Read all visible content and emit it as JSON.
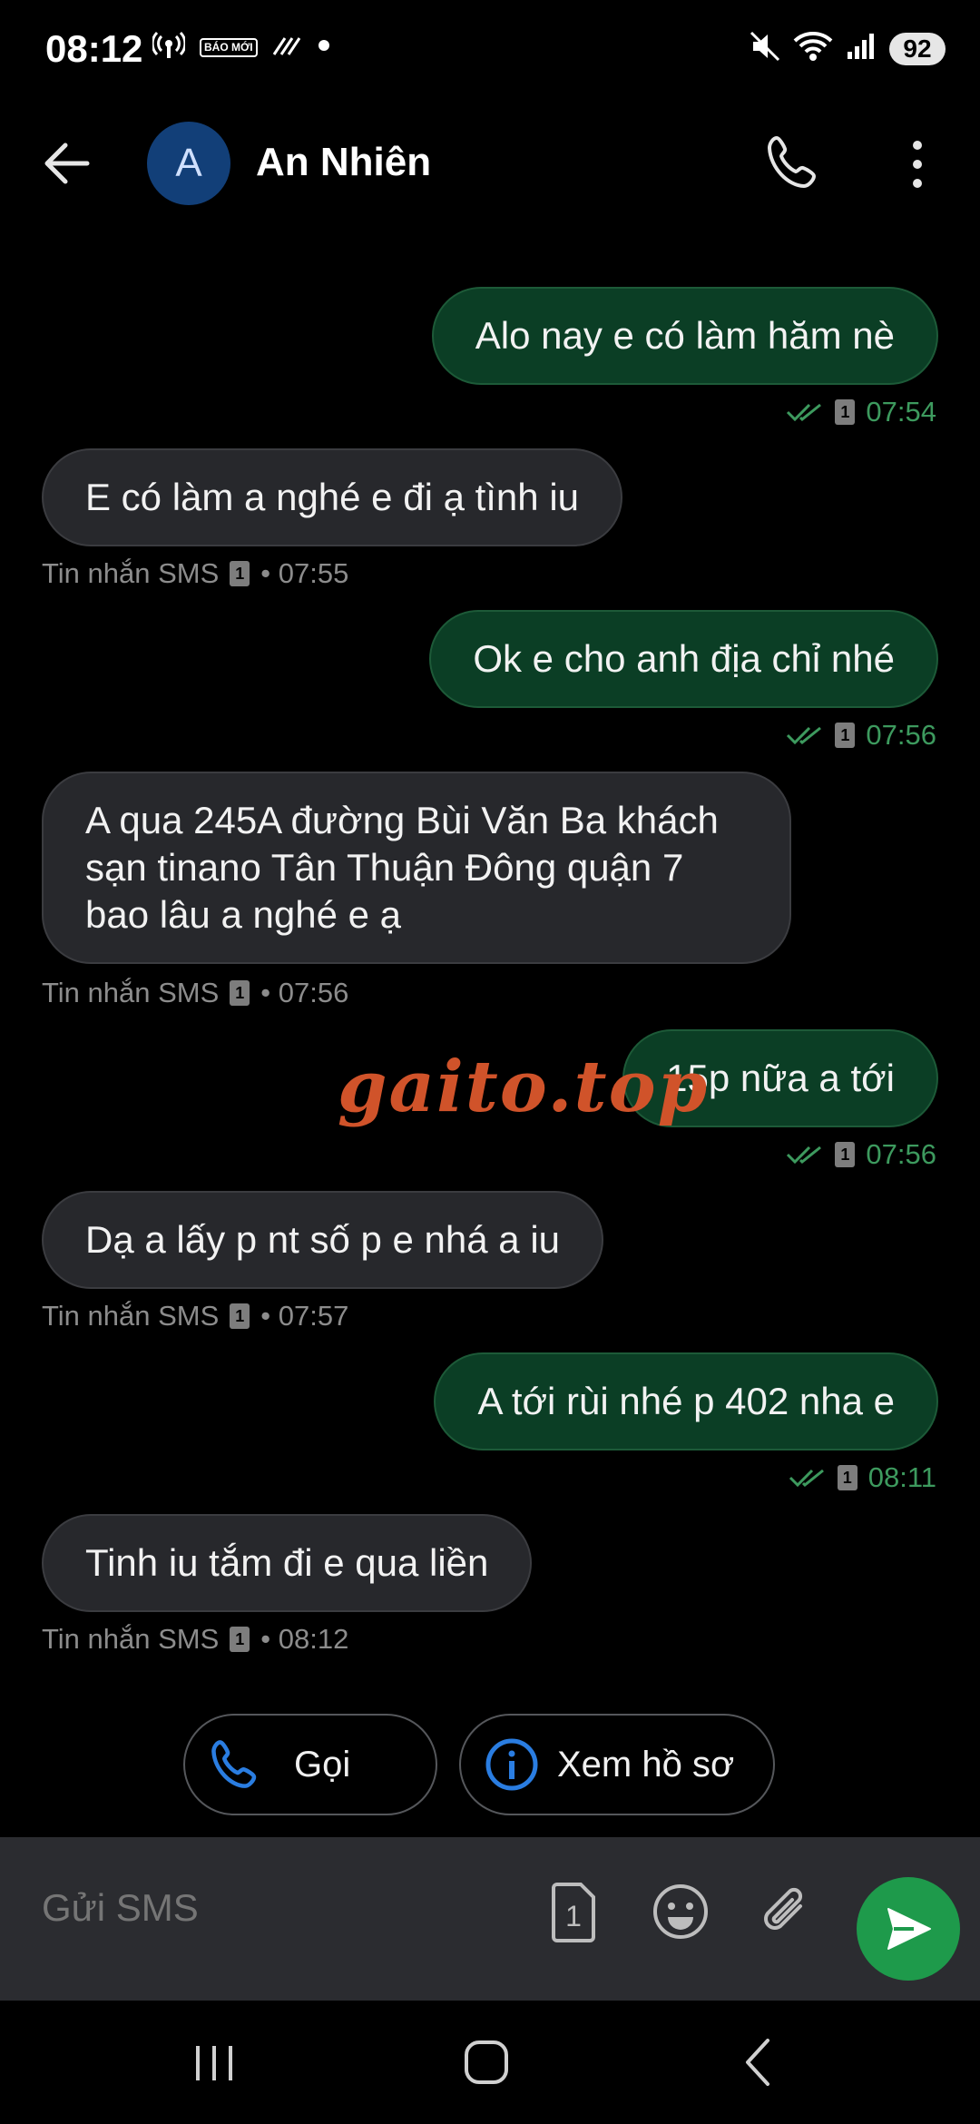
{
  "status_bar": {
    "time": "08:12",
    "baomoi_label": "BÁO MỚI",
    "battery": "92",
    "icons": [
      "hotspot-icon",
      "baomoi-icon",
      "data-saver-icon",
      "dot-icon",
      "mute-icon",
      "wifi-icon",
      "signal-icon",
      "battery-icon"
    ]
  },
  "header": {
    "avatar_letter": "A",
    "contact_name": "An Nhiên",
    "icons": [
      "back-arrow-icon",
      "phone-icon",
      "more-vert-icon"
    ]
  },
  "messages": [
    {
      "dir": "out",
      "text": "Alo nay e có làm hăm nè",
      "time": "07:54"
    },
    {
      "dir": "in",
      "text": "E có làm a nghé e đi ạ tình iu",
      "label": "Tin nhắn SMS",
      "time": "• 07:55"
    },
    {
      "dir": "out",
      "text": "Ok e cho anh địa chỉ nhé",
      "time": "07:56"
    },
    {
      "dir": "in",
      "text": "A qua 245A đường Bùi Văn Ba khách sạn tinano Tân Thuận Đông quận 7 bao lâu a nghé e ạ",
      "label": "Tin nhắn SMS",
      "time": "• 07:56"
    },
    {
      "dir": "out",
      "text": "15p nữa a tới",
      "time": "07:56"
    },
    {
      "dir": "in",
      "text": "Dạ a lấy p nt số p e nhá a iu",
      "label": "Tin nhắn SMS",
      "time": "• 07:57"
    },
    {
      "dir": "out",
      "text": "A tới rùi nhé p 402 nha e",
      "time": "08:11"
    },
    {
      "dir": "in",
      "text": "Tinh iu tắm đi e qua liền",
      "label": "Tin nhắn SMS",
      "time": "• 08:12"
    }
  ],
  "sim_label": "1",
  "watermark": "gaito.top",
  "actions": {
    "call_label": "Gọi",
    "profile_label": "Xem hồ sơ"
  },
  "composer": {
    "placeholder": "Gửi SMS",
    "sim_label": "1"
  },
  "colors": {
    "outgoing_bubble": "#0b3e25",
    "incoming_bubble": "#27282c",
    "send_button": "#1e9a4b",
    "avatar": "#123f78",
    "timestamp_out": "#3d9a5e",
    "icon_blue": "#2a7de1"
  }
}
